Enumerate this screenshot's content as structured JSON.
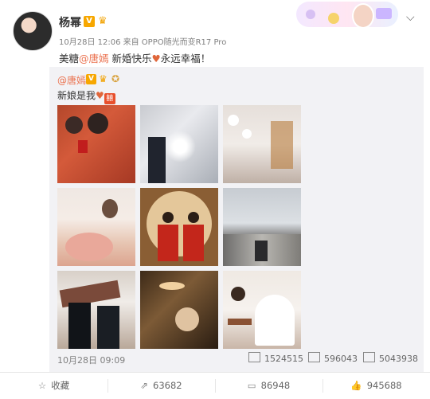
{
  "post": {
    "author": "杨幂",
    "meta": "10月28日 12:06 来自 OPPO随光而变R17 Pro",
    "text_prefix": "美糖",
    "mention": "@唐嫣",
    "text_mid": " 新婚快乐",
    "text_suffix": "永远幸福！"
  },
  "repost": {
    "author": "@唐嫣",
    "text": "新娘是我",
    "xi_char": "囍",
    "date": "10月28日 09:09",
    "reposts": "1524515",
    "comments": "596043",
    "likes": "5043938"
  },
  "actions": {
    "favorite": "收藏",
    "repost": "63682",
    "comment": "86948",
    "like": "945688"
  },
  "icons": {
    "crown": "crown-icon",
    "medal": "medal-icon",
    "heart": "heart-icon",
    "chevron": "chevron-down-icon"
  },
  "colors": {
    "accent": "#eb7350",
    "verify": "#f7a700"
  }
}
